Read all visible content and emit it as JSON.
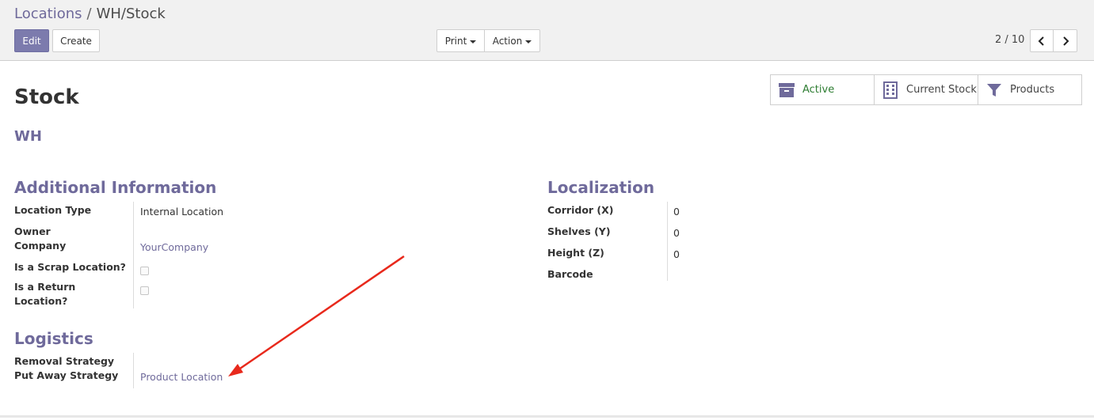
{
  "breadcrumb": {
    "parent": "Locations",
    "separator": "/",
    "current": "WH/Stock"
  },
  "toolbar": {
    "edit_label": "Edit",
    "create_label": "Create",
    "print_label": "Print",
    "action_label": "Action"
  },
  "pager": {
    "value": "2 / 10"
  },
  "smart_buttons": {
    "active": "Active",
    "current_stock": "Current Stock",
    "products": "Products"
  },
  "record": {
    "title": "Stock",
    "parent_location": "WH"
  },
  "additional_info": {
    "heading": "Additional Information",
    "location_type_label": "Location Type",
    "location_type_value": "Internal Location",
    "owner_company_label_1": "Owner",
    "owner_company_label_2": "Company",
    "owner_company_value": "YourCompany",
    "scrap_label": "Is a Scrap Location?",
    "return_label_1": "Is a Return",
    "return_label_2": "Location?"
  },
  "localization": {
    "heading": "Localization",
    "corridor_label": "Corridor (X)",
    "corridor_value": "0",
    "shelves_label": "Shelves (Y)",
    "shelves_value": "0",
    "height_label": "Height (Z)",
    "height_value": "0",
    "barcode_label": "Barcode"
  },
  "logistics": {
    "heading": "Logistics",
    "removal_label": "Removal Strategy",
    "putaway_label": "Put Away Strategy",
    "putaway_value": "Product Location"
  },
  "colors": {
    "brand": "#7c7bad",
    "link": "#6f6a9b",
    "active_green": "#2e7d32",
    "annotation_arrow": "#e8291c"
  }
}
